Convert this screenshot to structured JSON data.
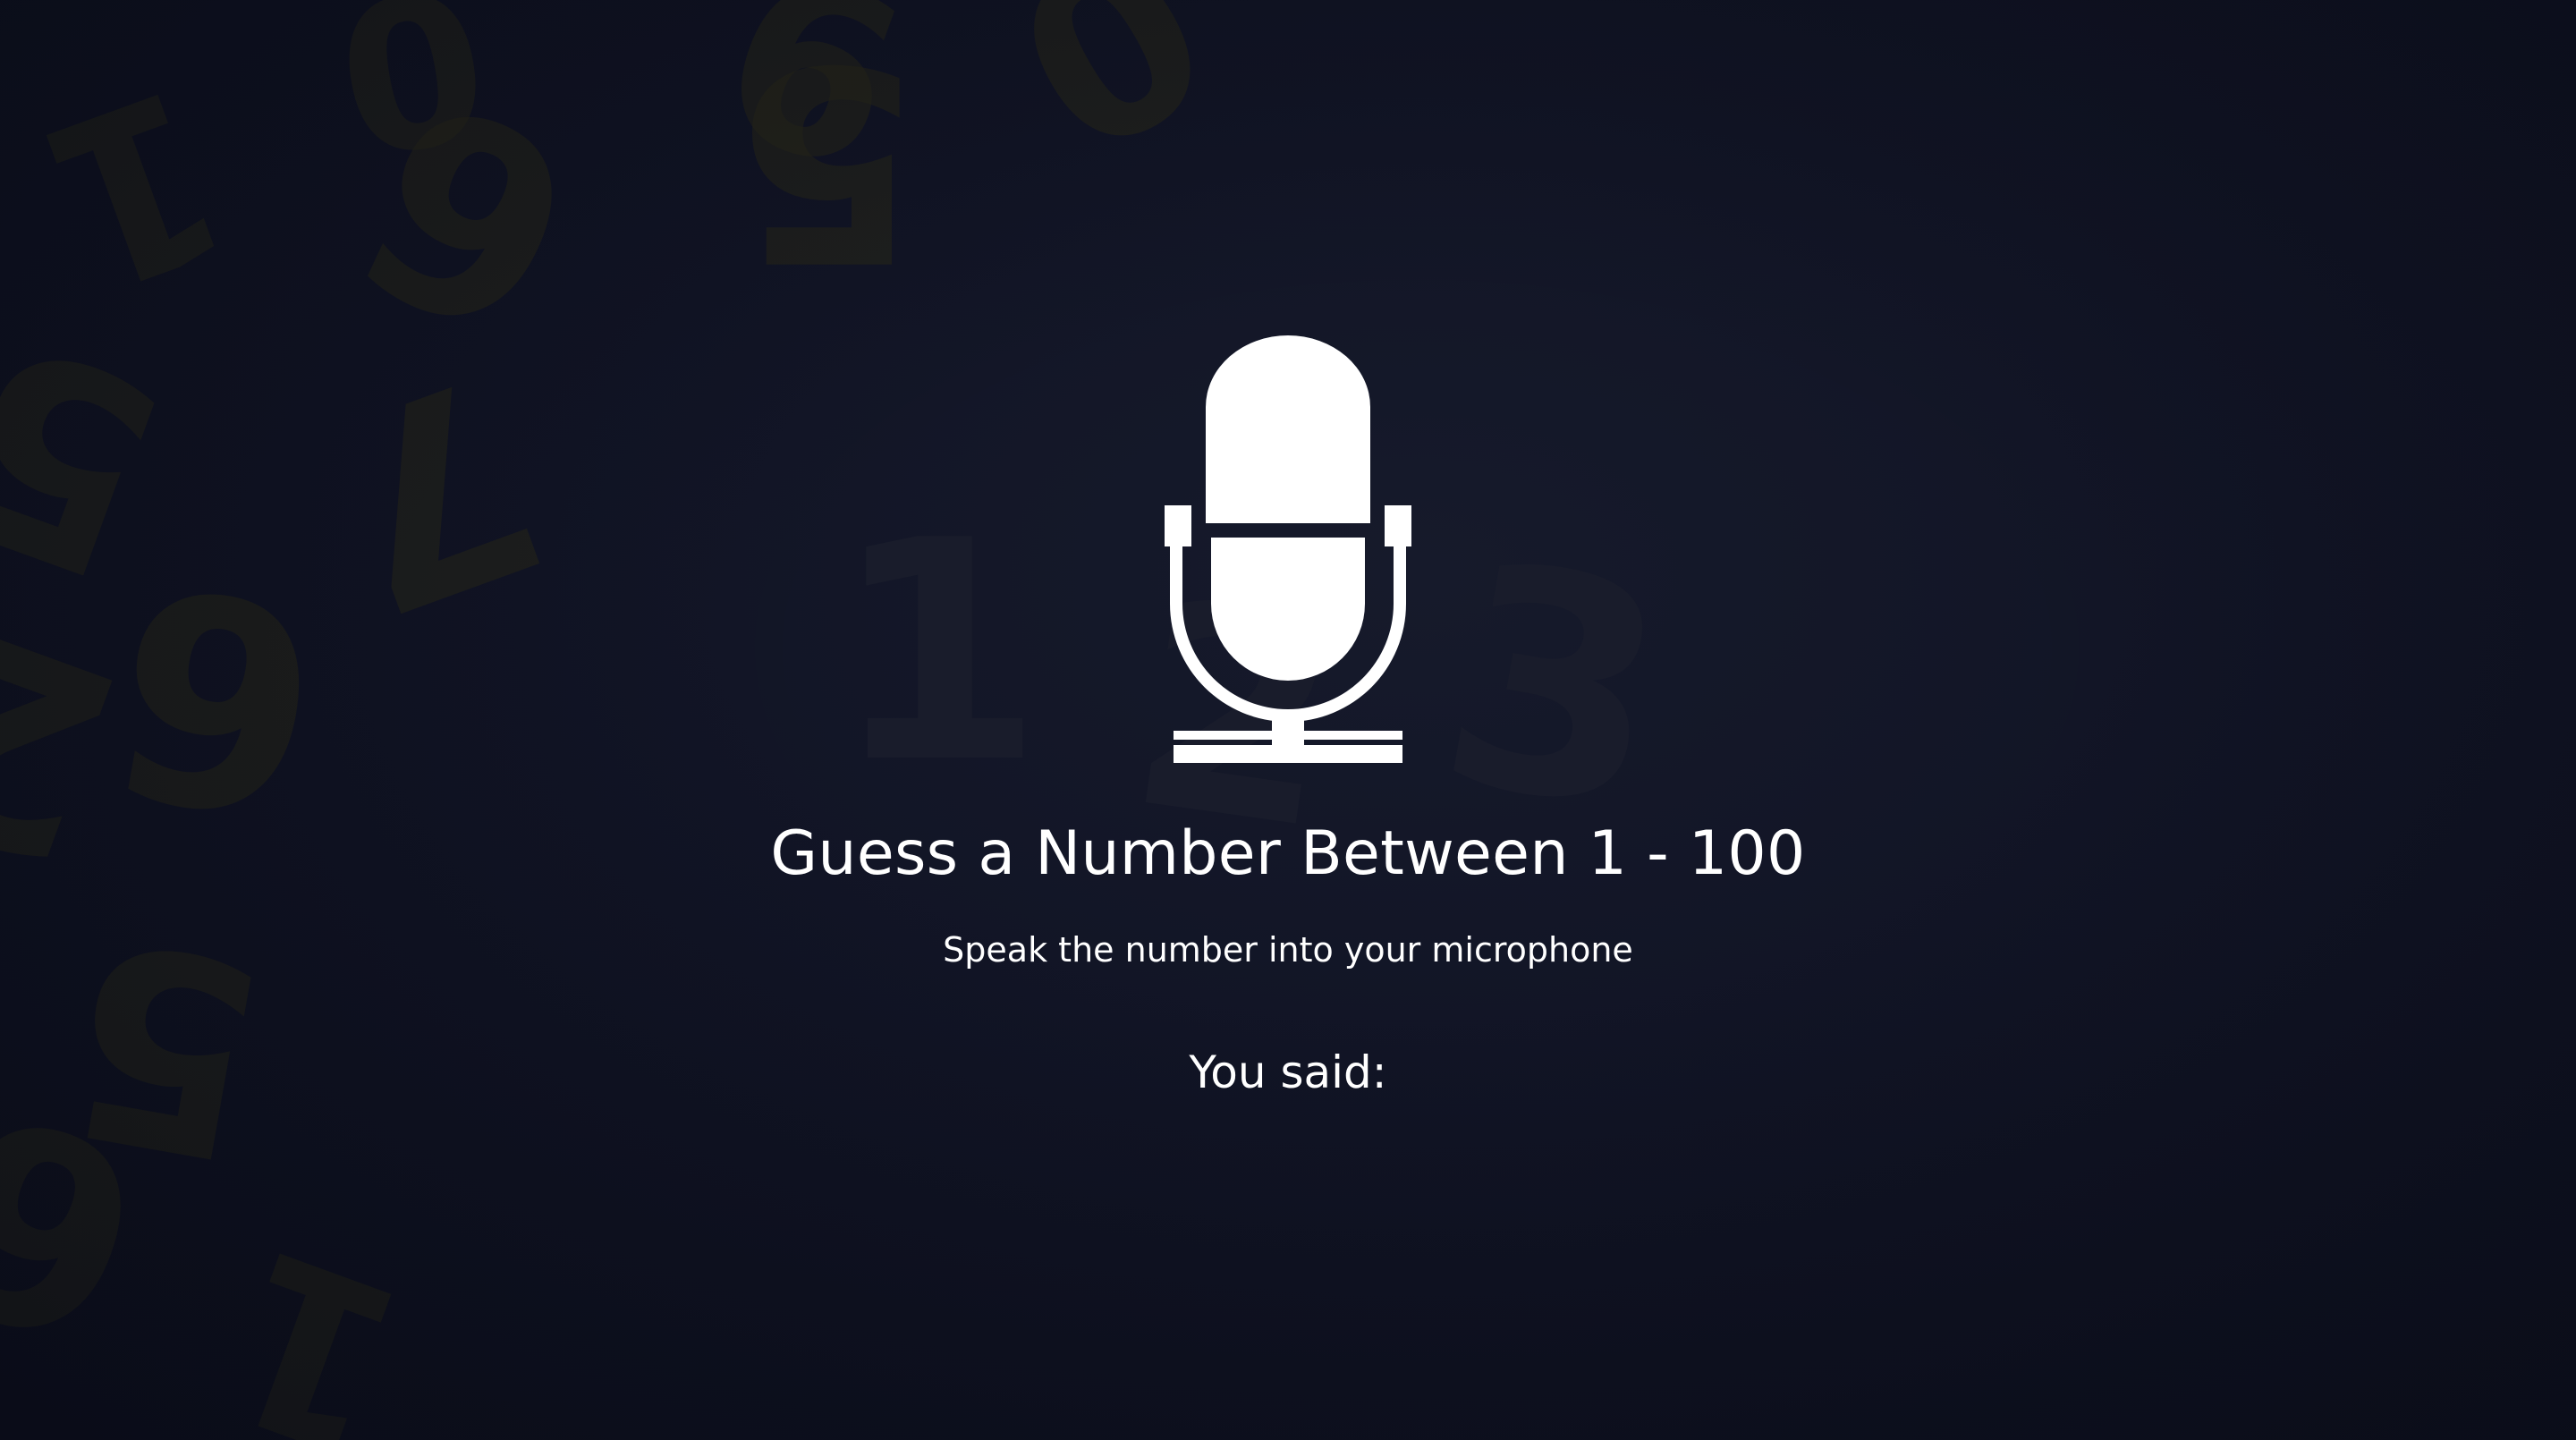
{
  "game": {
    "title": "Guess a Number Between 1 - 100",
    "instruction": "Speak the number into your microphone",
    "you_said_label": "You said:"
  },
  "icons": {
    "microphone": "microphone-icon"
  },
  "colors": {
    "background": "#111425",
    "text": "#ffffff",
    "digit_decor": "#2a2918"
  }
}
